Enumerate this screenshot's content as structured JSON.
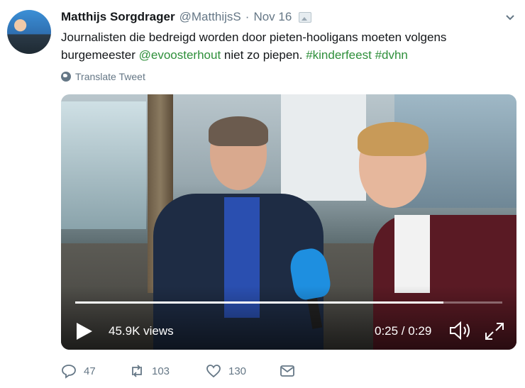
{
  "tweet": {
    "author_name": "Matthijs Sorgdrager",
    "handle": "@MatthijsS",
    "separator": "·",
    "date": "Nov 16",
    "text_parts": {
      "a": "Journalisten die bedreigd worden door pieten-hooligans moeten volgens burgemeester ",
      "mention": "@evoosterhout",
      "b": " niet zo piepen. ",
      "hashtag1": "#kinderfeest",
      "space": " ",
      "hashtag2": "#dvhn"
    },
    "translate_label": "Translate Tweet"
  },
  "video": {
    "views": "45.9K views",
    "time": "0:25 / 0:29",
    "progress": 0.862
  },
  "actions": {
    "replies": "47",
    "retweets": "103",
    "likes": "130"
  },
  "colors": {
    "link": "#2e8f3a",
    "muted": "#657786"
  },
  "icons": [
    "globe-icon",
    "chevron-down-icon",
    "play-icon",
    "volume-icon",
    "fullscreen-icon",
    "reply-icon",
    "retweet-icon",
    "like-icon",
    "message-icon"
  ]
}
